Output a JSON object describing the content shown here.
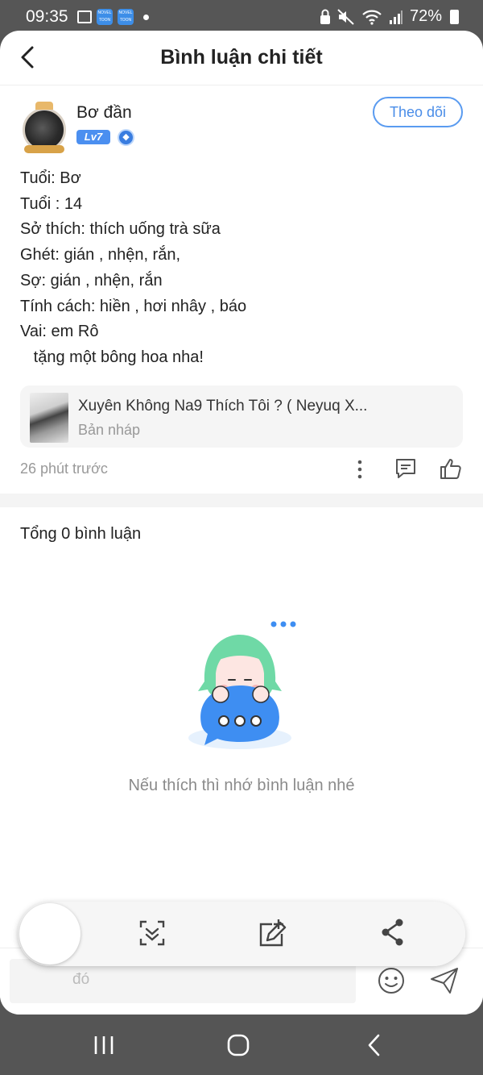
{
  "status_bar": {
    "time": "09:35",
    "app_badge_1": "NOVEL TOON",
    "app_badge_2": "NOVEL TOON",
    "battery": "72%"
  },
  "header": {
    "title": "Bình luận chi tiết"
  },
  "post": {
    "author": "Bơ đần",
    "level": "Lv7",
    "follow_label": "Theo dõi",
    "lines": [
      "Tuổi: Bơ",
      "Tuổi : 14",
      "Sở thích: thích uống trà sữa",
      "Ghét: gián , nhện, rắn,",
      "Sợ: gián , nhện, rắn",
      "Tính cách: hiền , hơi nhây , báo",
      "Vai: em Rô",
      "   tặng một bông hoa nha!"
    ],
    "book": {
      "title": "Xuyên Không Na9 Thích Tôi ? ( Neyuq X...",
      "status": "Bản nháp"
    },
    "time": "26 phút trước"
  },
  "comments": {
    "count_label": "Tổng 0 bình luận",
    "empty_text": "Nếu thích thì nhớ bình luận nhé"
  },
  "input": {
    "placeholder": "đó"
  },
  "colors": {
    "accent": "#4a8de8",
    "mascot_hair": "#6fd9a6",
    "bubble": "#3e8ef2"
  }
}
